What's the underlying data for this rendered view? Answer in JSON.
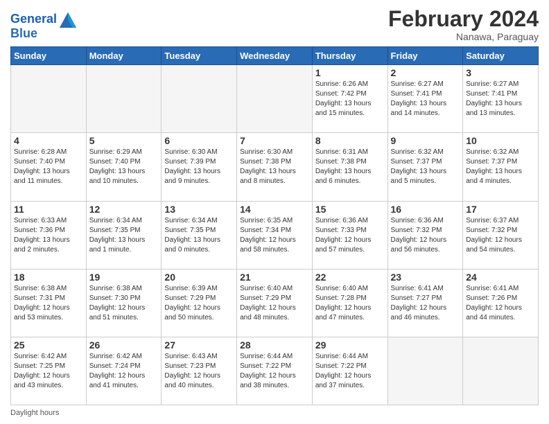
{
  "header": {
    "logo_line1": "General",
    "logo_line2": "Blue",
    "main_title": "February 2024",
    "subtitle": "Nanawa, Paraguay"
  },
  "days_of_week": [
    "Sunday",
    "Monday",
    "Tuesday",
    "Wednesday",
    "Thursday",
    "Friday",
    "Saturday"
  ],
  "weeks": [
    [
      {
        "num": "",
        "detail": ""
      },
      {
        "num": "",
        "detail": ""
      },
      {
        "num": "",
        "detail": ""
      },
      {
        "num": "",
        "detail": ""
      },
      {
        "num": "1",
        "detail": "Sunrise: 6:26 AM\nSunset: 7:42 PM\nDaylight: 13 hours\nand 15 minutes."
      },
      {
        "num": "2",
        "detail": "Sunrise: 6:27 AM\nSunset: 7:41 PM\nDaylight: 13 hours\nand 14 minutes."
      },
      {
        "num": "3",
        "detail": "Sunrise: 6:27 AM\nSunset: 7:41 PM\nDaylight: 13 hours\nand 13 minutes."
      }
    ],
    [
      {
        "num": "4",
        "detail": "Sunrise: 6:28 AM\nSunset: 7:40 PM\nDaylight: 13 hours\nand 11 minutes."
      },
      {
        "num": "5",
        "detail": "Sunrise: 6:29 AM\nSunset: 7:40 PM\nDaylight: 13 hours\nand 10 minutes."
      },
      {
        "num": "6",
        "detail": "Sunrise: 6:30 AM\nSunset: 7:39 PM\nDaylight: 13 hours\nand 9 minutes."
      },
      {
        "num": "7",
        "detail": "Sunrise: 6:30 AM\nSunset: 7:38 PM\nDaylight: 13 hours\nand 8 minutes."
      },
      {
        "num": "8",
        "detail": "Sunrise: 6:31 AM\nSunset: 7:38 PM\nDaylight: 13 hours\nand 6 minutes."
      },
      {
        "num": "9",
        "detail": "Sunrise: 6:32 AM\nSunset: 7:37 PM\nDaylight: 13 hours\nand 5 minutes."
      },
      {
        "num": "10",
        "detail": "Sunrise: 6:32 AM\nSunset: 7:37 PM\nDaylight: 13 hours\nand 4 minutes."
      }
    ],
    [
      {
        "num": "11",
        "detail": "Sunrise: 6:33 AM\nSunset: 7:36 PM\nDaylight: 13 hours\nand 2 minutes."
      },
      {
        "num": "12",
        "detail": "Sunrise: 6:34 AM\nSunset: 7:35 PM\nDaylight: 13 hours\nand 1 minute."
      },
      {
        "num": "13",
        "detail": "Sunrise: 6:34 AM\nSunset: 7:35 PM\nDaylight: 13 hours\nand 0 minutes."
      },
      {
        "num": "14",
        "detail": "Sunrise: 6:35 AM\nSunset: 7:34 PM\nDaylight: 12 hours\nand 58 minutes."
      },
      {
        "num": "15",
        "detail": "Sunrise: 6:36 AM\nSunset: 7:33 PM\nDaylight: 12 hours\nand 57 minutes."
      },
      {
        "num": "16",
        "detail": "Sunrise: 6:36 AM\nSunset: 7:32 PM\nDaylight: 12 hours\nand 56 minutes."
      },
      {
        "num": "17",
        "detail": "Sunrise: 6:37 AM\nSunset: 7:32 PM\nDaylight: 12 hours\nand 54 minutes."
      }
    ],
    [
      {
        "num": "18",
        "detail": "Sunrise: 6:38 AM\nSunset: 7:31 PM\nDaylight: 12 hours\nand 53 minutes."
      },
      {
        "num": "19",
        "detail": "Sunrise: 6:38 AM\nSunset: 7:30 PM\nDaylight: 12 hours\nand 51 minutes."
      },
      {
        "num": "20",
        "detail": "Sunrise: 6:39 AM\nSunset: 7:29 PM\nDaylight: 12 hours\nand 50 minutes."
      },
      {
        "num": "21",
        "detail": "Sunrise: 6:40 AM\nSunset: 7:29 PM\nDaylight: 12 hours\nand 48 minutes."
      },
      {
        "num": "22",
        "detail": "Sunrise: 6:40 AM\nSunset: 7:28 PM\nDaylight: 12 hours\nand 47 minutes."
      },
      {
        "num": "23",
        "detail": "Sunrise: 6:41 AM\nSunset: 7:27 PM\nDaylight: 12 hours\nand 46 minutes."
      },
      {
        "num": "24",
        "detail": "Sunrise: 6:41 AM\nSunset: 7:26 PM\nDaylight: 12 hours\nand 44 minutes."
      }
    ],
    [
      {
        "num": "25",
        "detail": "Sunrise: 6:42 AM\nSunset: 7:25 PM\nDaylight: 12 hours\nand 43 minutes."
      },
      {
        "num": "26",
        "detail": "Sunrise: 6:42 AM\nSunset: 7:24 PM\nDaylight: 12 hours\nand 41 minutes."
      },
      {
        "num": "27",
        "detail": "Sunrise: 6:43 AM\nSunset: 7:23 PM\nDaylight: 12 hours\nand 40 minutes."
      },
      {
        "num": "28",
        "detail": "Sunrise: 6:44 AM\nSunset: 7:22 PM\nDaylight: 12 hours\nand 38 minutes."
      },
      {
        "num": "29",
        "detail": "Sunrise: 6:44 AM\nSunset: 7:22 PM\nDaylight: 12 hours\nand 37 minutes."
      },
      {
        "num": "",
        "detail": ""
      },
      {
        "num": "",
        "detail": ""
      }
    ]
  ],
  "footer": {
    "label": "Daylight hours"
  }
}
